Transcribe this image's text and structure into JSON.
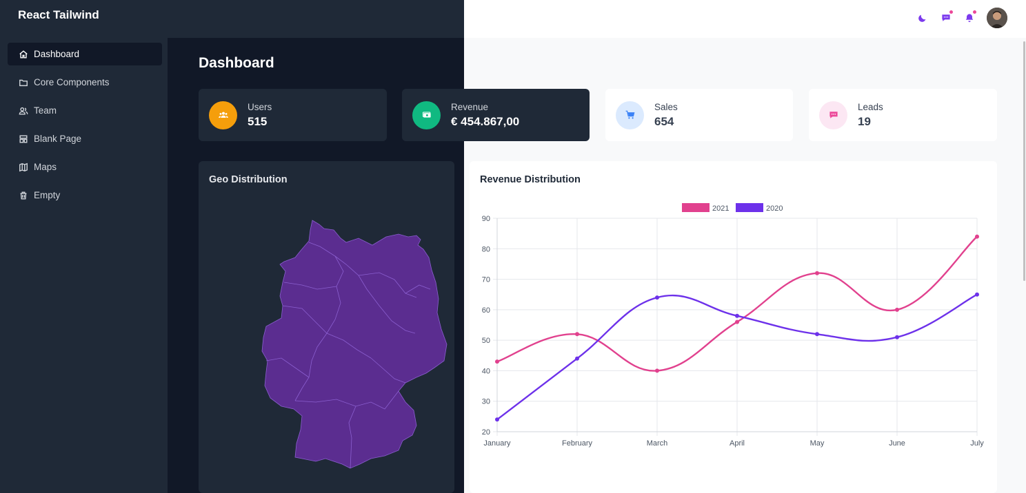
{
  "app": {
    "brand": "React Tailwind"
  },
  "sidebar": {
    "items": [
      {
        "label": "Dashboard",
        "icon": "home-icon",
        "active": true
      },
      {
        "label": "Core Components",
        "icon": "folder-icon",
        "active": false
      },
      {
        "label": "Team",
        "icon": "users-icon",
        "active": false
      },
      {
        "label": "Blank Page",
        "icon": "template-icon",
        "active": false
      },
      {
        "label": "Maps",
        "icon": "map-icon",
        "active": false
      },
      {
        "label": "Empty",
        "icon": "trash-icon",
        "active": false
      }
    ]
  },
  "header": {
    "icons": [
      "moon-icon",
      "chat-icon",
      "bell-icon"
    ],
    "avatar": "user-avatar"
  },
  "main": {
    "title": "Dashboard",
    "stats": [
      {
        "label": "Users",
        "value": "515",
        "icon": "users-group-icon",
        "color": "#f59e0b"
      },
      {
        "label": "Revenue",
        "value": "€ 454.867,00",
        "icon": "cash-icon",
        "color": "#10b981"
      },
      {
        "label": "Sales",
        "value": "654",
        "icon": "cart-icon",
        "color": "#3b82f6"
      },
      {
        "label": "Leads",
        "value": "19",
        "icon": "chat-bubble-icon",
        "color": "#ec4899"
      }
    ],
    "geo": {
      "title": "Geo Distribution",
      "map_color": "#5b2d90"
    },
    "revenue": {
      "title": "Revenue Distribution"
    }
  },
  "chart_data": {
    "type": "line",
    "title": "Revenue Distribution",
    "categories": [
      "January",
      "February",
      "March",
      "April",
      "May",
      "June",
      "July"
    ],
    "series": [
      {
        "name": "2021",
        "color": "#e1418e",
        "values": [
          43,
          52,
          40,
          56,
          72,
          60,
          84
        ]
      },
      {
        "name": "2020",
        "color": "#6d31ea",
        "values": [
          24,
          44,
          64,
          58,
          52,
          51,
          65
        ]
      }
    ],
    "ylim": [
      20,
      90
    ],
    "yticks": [
      20,
      30,
      40,
      50,
      60,
      70,
      80,
      90
    ],
    "grid": true,
    "legend": "top-center",
    "xlabel": "",
    "ylabel": ""
  }
}
